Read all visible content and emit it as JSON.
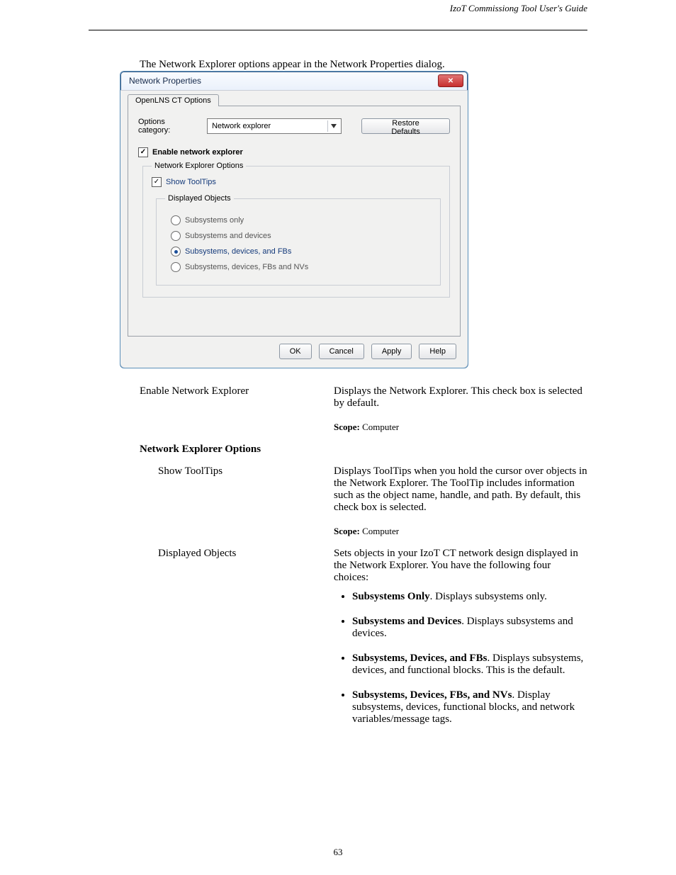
{
  "header_text": "IzoT Commissiong Tool User's Guide",
  "intro_sentence": "The Network Explorer options appear in the Network Properties dialog.",
  "dialog": {
    "title": "Network Properties",
    "close_glyph": "✕",
    "tab_label": "OpenLNS CT Options",
    "options_category_label": "Options category:",
    "options_category_value": "Network explorer",
    "restore_defaults": "Restore Defaults",
    "enable_checkbox_label": "Enable network explorer",
    "group_network_explorer_options": "Network Explorer Options",
    "show_tooltips_label": "Show ToolTips",
    "displayed_objects_legend": "Displayed Objects",
    "radios": {
      "subsystems_only": "Subsystems only",
      "subsystems_and_devices": "Subsystems and devices",
      "subs_dev_fbs": "Subsystems, devices, and FBs",
      "subs_dev_fbs_nvs": "Subsystems, devices, FBs and NVs"
    },
    "buttons": {
      "ok": "OK",
      "cancel": "Cancel",
      "apply": "Apply",
      "help": "Help"
    }
  },
  "desc": {
    "enable_ne_label": "Enable Network Explorer",
    "enable_ne_text_before_scope": "Displays the Network Explorer. This check box is selected by default.",
    "scope_label": "Scope:",
    "scope_value": "Computer",
    "group_title": "Network Explorer Options",
    "show_tooltips_label": "Show ToolTips",
    "show_tooltips_text": "Displays ToolTips when you hold the cursor over objects in the Network Explorer. The ToolTip includes information such as the object name, handle, and path. By default, this check box is selected.",
    "displayed_objects_label": "Displayed Objects",
    "displayed_objects_intro": "Sets objects in your IzoT CT network design displayed in the Network Explorer. You have the following four choices:",
    "bullets": {
      "b1_bold": "Subsystems Only",
      "b1_rest": ". Displays subsystems only.",
      "b2_bold": "Subsystems and Devices",
      "b2_rest": ". Displays subsystems and devices.",
      "b3_bold": "Subsystems, Devices, and FBs",
      "b3_rest": ". Displays subsystems, devices, and functional blocks. This is the default.",
      "b4_bold": "Subsystems, Devices, FBs, and NVs",
      "b4_rest": ". Display subsystems, devices, functional blocks, and network variables/message tags."
    }
  },
  "page_number": "63"
}
